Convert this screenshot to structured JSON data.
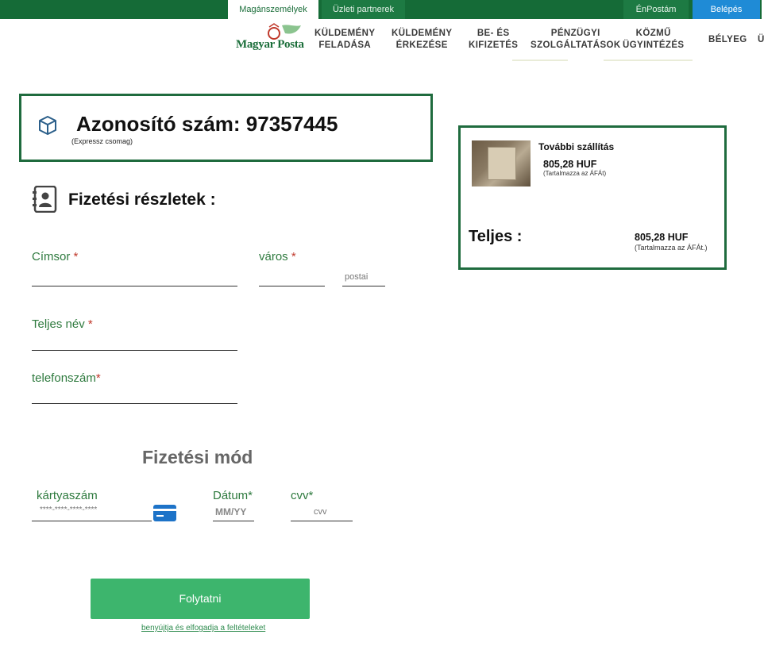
{
  "header": {
    "tabs": [
      "Magánszemélyek",
      "Üzleti partnerek"
    ],
    "enpostam": "ÉnPostám",
    "login": "Belépés",
    "logo_text": "Magyar Posta",
    "nav": [
      "KÜLDEMÉNY\nFELADÁSA",
      "KÜLDEMÉNY\nÉRKEZÉSE",
      "BE- ÉS\nKIFIZETÉS",
      "PÉNZÜGYI\nSZOLGÁLTATÁSOK",
      "KÖZMŰ\nÜGYINTÉZÉS",
      "BÉLYEG",
      "Ü"
    ]
  },
  "identifier": {
    "title": "Azonosító szám: 97357445",
    "subtitle": "(Expressz csomag)"
  },
  "summary": {
    "item_title": "További szállítás",
    "item_price": "805,28 HUF",
    "item_vat": "(Tartalmazza az ÁFÁt)",
    "total_label": "Teljes  :",
    "total_price": "805,28 HUF",
    "total_vat": "(Tartalmazza az ÁFÁt.)"
  },
  "form": {
    "section_title": "Fizetési részletek :",
    "address_label": "Címsor ",
    "city_label": "város ",
    "postal_placeholder": "postai",
    "fullname_label": "Teljes név ",
    "phone_label": "telefonszám",
    "required_mark": "*"
  },
  "payment": {
    "title": "Fizetési mód",
    "card_label": "kártyaszám",
    "card_placeholder": "****-****-****-****",
    "date_label": "Dátum*",
    "date_placeholder": "MM/YY",
    "cvv_label": "cvv*",
    "cvv_placeholder": "cvv"
  },
  "actions": {
    "continue": "Folytatni",
    "terms": "benyújtja és elfogadja a feltételeket"
  },
  "colors": {
    "brand_green": "#156b37",
    "accent_green": "#3db56d",
    "login_blue": "#1f8bd6"
  }
}
